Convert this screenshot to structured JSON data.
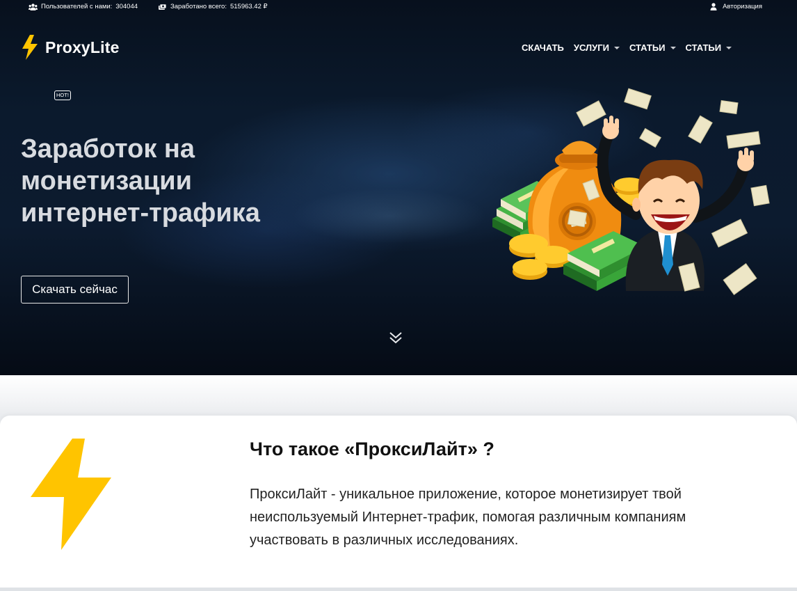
{
  "topbar": {
    "users_label": "Пользователей с нами:",
    "users_count": "304044",
    "earned_label": "Заработано всего:",
    "earned_value": "515963.42 ₽",
    "login_label": "Авторизация"
  },
  "brand": {
    "name": "ProxyLite"
  },
  "nav": [
    {
      "label": "СКАЧАТЬ",
      "has_dropdown": false
    },
    {
      "label": "УСЛУГИ",
      "has_dropdown": true
    },
    {
      "label": "СТАТЬИ",
      "has_dropdown": true
    },
    {
      "label": "СТАТЬИ",
      "has_dropdown": true
    }
  ],
  "hero": {
    "badge": "HOT!",
    "headline": [
      "Заработок на",
      "монетизации",
      "интернет-трафика"
    ],
    "cta_label": "Скачать сейчас"
  },
  "about": {
    "title": "Что такое «ПроксиЛайт» ?",
    "text": "ПроксиЛайт - уникальное приложение, которое монетизирует твой неиспользуемый Интернет-трафик, помогая различным компаниям участвовать в различных исследованиях."
  },
  "colors": {
    "accent_yellow": "#ffc400",
    "hero_dark": "#0b1a2d",
    "card_bg": "#ffffff"
  }
}
